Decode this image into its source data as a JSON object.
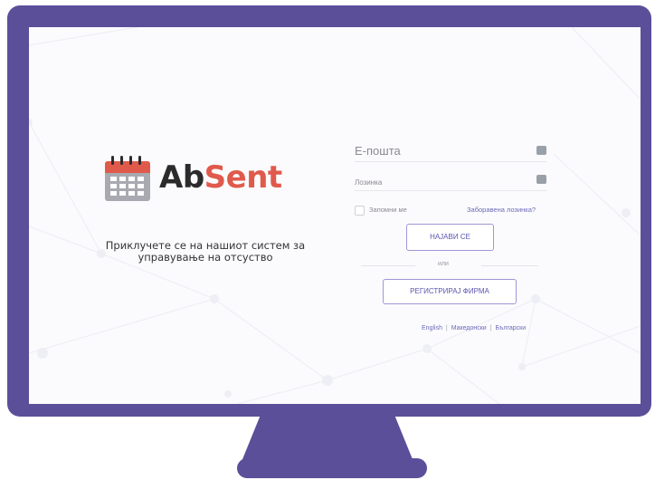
{
  "brand": {
    "ab": "Ab",
    "sent": "Sent"
  },
  "tagline": {
    "line1": "Приклучете се на нашиот систем за",
    "line2": "управување на отсуство"
  },
  "login_form": {
    "email_placeholder": "Е-пошта",
    "password_placeholder": "Лозинка",
    "remember_label": "Запомни ме",
    "forgot_link": "Заборавена лозинка?",
    "login_button": "НАЈАВИ СЕ",
    "or_text": "или",
    "register_button": "РЕГИСТРИРАЈ ФИРМА"
  },
  "languages": [
    "English",
    "Македонски",
    "Български"
  ],
  "language_separator": "|",
  "colors": {
    "monitor": "#5b4f9a",
    "brand_dark": "#2b2b2b",
    "brand_accent": "#e05a4c",
    "button_border": "#9d98d6",
    "link": "#6c6ab8"
  },
  "icons": {
    "calendar": "calendar-icon",
    "key": "key-icon"
  }
}
